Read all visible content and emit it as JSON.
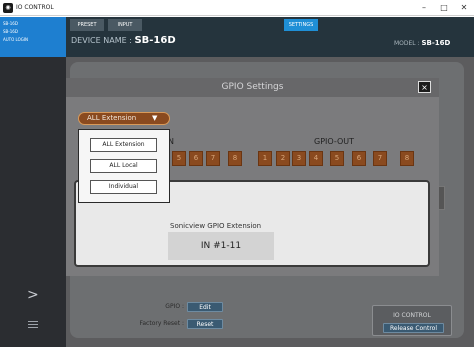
{
  "window": {
    "title": "IO CONTROL",
    "icon": "app-icon",
    "controls": [
      "–",
      "□",
      "✕"
    ]
  },
  "sidebar": {
    "devices": [
      "SB-16D",
      "SB-16D",
      "AUTO LOGIN"
    ],
    "expand_glyph": ">"
  },
  "header": {
    "tabs": [
      "PRESET",
      "INPUT",
      "SETTINGS"
    ],
    "active_tab": "SETTINGS",
    "device_name_label": "DEVICE NAME :",
    "device_name": "SB-16D",
    "model_label": "MODEL :",
    "model": "SB-16D"
  },
  "background": {
    "gpio_label": "GPIO :",
    "gpio_button": "Edit",
    "factory_reset_label": "Factory Reset :",
    "factory_reset_button": "Reset",
    "io_control_title": "IO CONTROL",
    "release_button": "Release Control",
    "right_button": "N"
  },
  "dialog": {
    "title": "GPIO Settings",
    "close": "×",
    "mode_selected": "ALL Extension",
    "mode_arrow": "▼",
    "gpio_in_label": "N",
    "gpio_out_label": "GPIO-OUT",
    "gpio_in_buttons": [
      "5",
      "6",
      "7",
      "8"
    ],
    "gpio_out_buttons": [
      "1",
      "2",
      "3",
      "4",
      "5",
      "6",
      "7",
      "8"
    ],
    "extension_title": "Sonicview GPIO Extension",
    "extension_value": "IN #1-11",
    "mode_options": [
      "ALL Extension",
      "ALL Local",
      "Individual"
    ]
  },
  "colors": {
    "accent": "#1f8fd6",
    "gpio_button": "#8a4a1f",
    "header_bg": "#25343d",
    "sidebar_bg": "#2b2d31"
  }
}
